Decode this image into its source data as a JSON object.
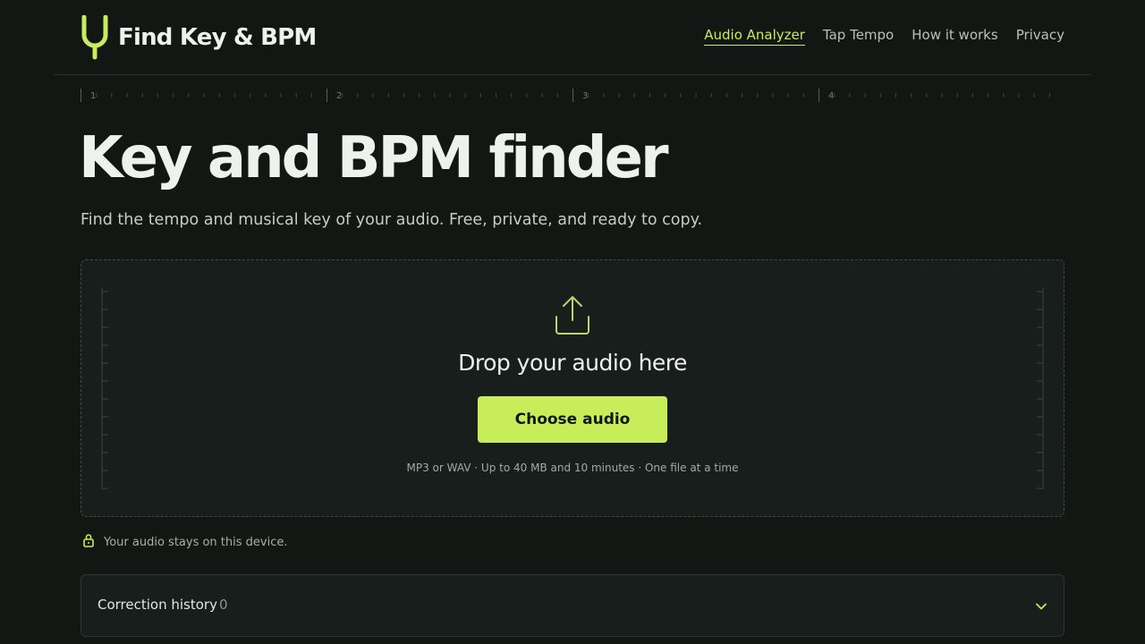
{
  "header": {
    "brand_name": "Find Key & BPM",
    "nav": [
      {
        "label": "Audio Analyzer",
        "active": true
      },
      {
        "label": "Tap Tempo",
        "active": false
      },
      {
        "label": "How it works",
        "active": false
      },
      {
        "label": "Privacy",
        "active": false
      }
    ]
  },
  "ruler": {
    "markers": [
      "1",
      "2",
      "3",
      "4"
    ]
  },
  "hero": {
    "title": "Key and BPM finder",
    "subtitle": "Find the tempo and musical key of your audio. Free, private, and ready to copy."
  },
  "dropzone": {
    "icon": "upload-icon",
    "title": "Drop your audio here",
    "button_label": "Choose audio",
    "hint": "MP3 or WAV · Up to 40 MB and 10 minutes · One file at a time"
  },
  "privacy_note": {
    "icon": "lock-icon",
    "text": "Your audio stays on this device."
  },
  "history": {
    "label": "Correction history",
    "count": "0",
    "icon": "chevron-down-icon"
  },
  "colors": {
    "background": "#121714",
    "accent": "#c7ee5a",
    "panel": "#181e1b"
  }
}
